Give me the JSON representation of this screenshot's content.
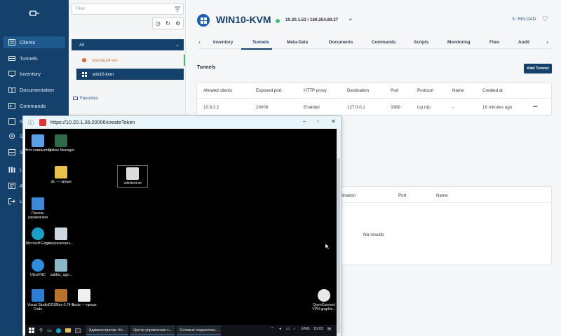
{
  "sidebar": {
    "items": [
      {
        "label": "Clients",
        "icon": "list-icon",
        "active": true
      },
      {
        "label": "Tunnels",
        "icon": "tunnel-icon"
      },
      {
        "label": "Inventory",
        "icon": "monitor-icon"
      },
      {
        "label": "Documentation",
        "icon": "book-icon"
      },
      {
        "label": "Commands",
        "icon": "terminal-icon"
      },
      {
        "label": "S",
        "icon": "scripts-icon"
      },
      {
        "label": "S",
        "icon": "settings-icon"
      },
      {
        "label": "S",
        "icon": "storage-icon"
      },
      {
        "label": "L",
        "icon": "library-icon"
      },
      {
        "label": "A",
        "icon": "audit-icon"
      },
      {
        "label": "L",
        "icon": "logout-icon"
      }
    ]
  },
  "panel": {
    "filter_placeholder": "Filter",
    "group_label": "All",
    "clients": [
      "ubuntu24-vm",
      "win10-kvm"
    ],
    "favorites_label": "Favorites"
  },
  "main": {
    "client_name": "WIN10-KVM",
    "ips": "10.20.1.53  /  169.254.89.27",
    "reload_label": "RELOAD",
    "tabs": [
      "Inventory",
      "Tunnels",
      "Meta-Data",
      "Documents",
      "Commands",
      "Scripts",
      "Monitoring",
      "Files",
      "Audit"
    ],
    "active_tab": "Tunnels",
    "section_title": "Tunnels",
    "add_button": "Add Tunnel",
    "tunnels_table": {
      "headers": [
        "Allowed clients",
        "Exposed port",
        "HTTP proxy",
        "Destination",
        "Port",
        "Protocol",
        "Name",
        "Created at"
      ],
      "rows": [
        [
          "10.8.2.2",
          "20006",
          "Enabled",
          "127.0.0.1",
          "3389",
          "tcp:rdp",
          "-",
          "16 minutes ago"
        ]
      ],
      "row_menu": "•••"
    },
    "second_table": {
      "headers": [
        "stination",
        "Port",
        "Name"
      ],
      "empty_text": "No results"
    }
  },
  "vnc_window": {
    "url": "https://10.20.1.36:20006/createToken",
    "desktop_icons": [
      {
        "label": "Этот компьютер",
        "color": "#5aa0e6"
      },
      {
        "label": "Outline Manager",
        "color": "#2e6a4a"
      },
      {
        "label": "dic — ярлык",
        "color": "#e6c24a"
      },
      {
        "label": "vdiclient.ini",
        "color": "#dcdcdc"
      },
      {
        "label": "Панель управления",
        "color": "#3a8ad8"
      },
      {
        "label": "Microsoft Edge",
        "color": "#1aa0c8"
      },
      {
        "label": "переключать...",
        "color": "#cfd8e0"
      },
      {
        "label": "UltraVNC",
        "color": "#2d8ee0"
      },
      {
        "label": "zabbix_age...",
        "color": "#8ab8c8"
      },
      {
        "label": "Visual Studio Code",
        "color": "#2a7fd4"
      },
      {
        "label": "DOSBox 0.74-3",
        "color": "#b8722a"
      },
      {
        "label": "hosts — ярлык",
        "color": "#f0f0f0"
      },
      {
        "label": "OpenConnect VPN graphic...",
        "color": "#e8e8e8"
      }
    ],
    "taskbar": [
      "Администратор: Ко...",
      "Центр управления с...",
      "Сетевые подключен..."
    ],
    "tray_lang": "ENG",
    "tray_time": "15:03"
  }
}
